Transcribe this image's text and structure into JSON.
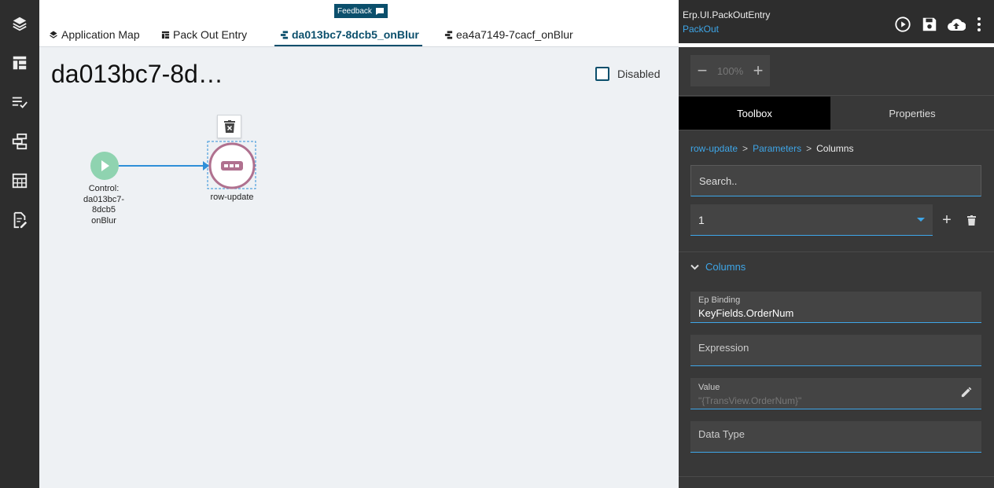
{
  "tabs": [
    {
      "label": "Application Map"
    },
    {
      "label": "Pack Out Entry"
    },
    {
      "label": "da013bc7-8dcb5_onBlur"
    },
    {
      "label": "ea4a7149-7cacf_onBlur"
    }
  ],
  "feedback_label": "Feedback",
  "page": {
    "title": "da013bc7-8d…",
    "disabled_label": "Disabled"
  },
  "canvas": {
    "start_node": {
      "line1": "Control:",
      "line2": "da013bc7-",
      "line3": "8dcb5",
      "line4": "onBlur"
    },
    "action_node": {
      "label": "row-update"
    }
  },
  "panel": {
    "app_name": "Erp.UI.PackOutEntry",
    "app_sub": "PackOut",
    "zoom": "100%",
    "zoom_minus": "−",
    "zoom_plus": "+",
    "tab_toolbox": "Toolbox",
    "tab_properties": "Properties",
    "breadcrumb": [
      {
        "label": "row-update"
      },
      {
        "label": "Parameters"
      },
      {
        "label": "Columns"
      }
    ],
    "search_placeholder": "Search..",
    "select_value": "1",
    "add": "+",
    "section": "Columns",
    "fields": {
      "ep_binding_label": "Ep Binding",
      "ep_binding_value": "KeyFields.OrderNum",
      "expression_label": "Expression",
      "value_label": "Value",
      "value_placeholder": "\"{TransView.OrderNum}\"",
      "data_type_label": "Data Type"
    }
  },
  "colors": {
    "accent": "#3ea6e8",
    "active_tab": "#0b4f6c",
    "start_node": "#8fd3b0",
    "action_node": "#b0718f"
  }
}
